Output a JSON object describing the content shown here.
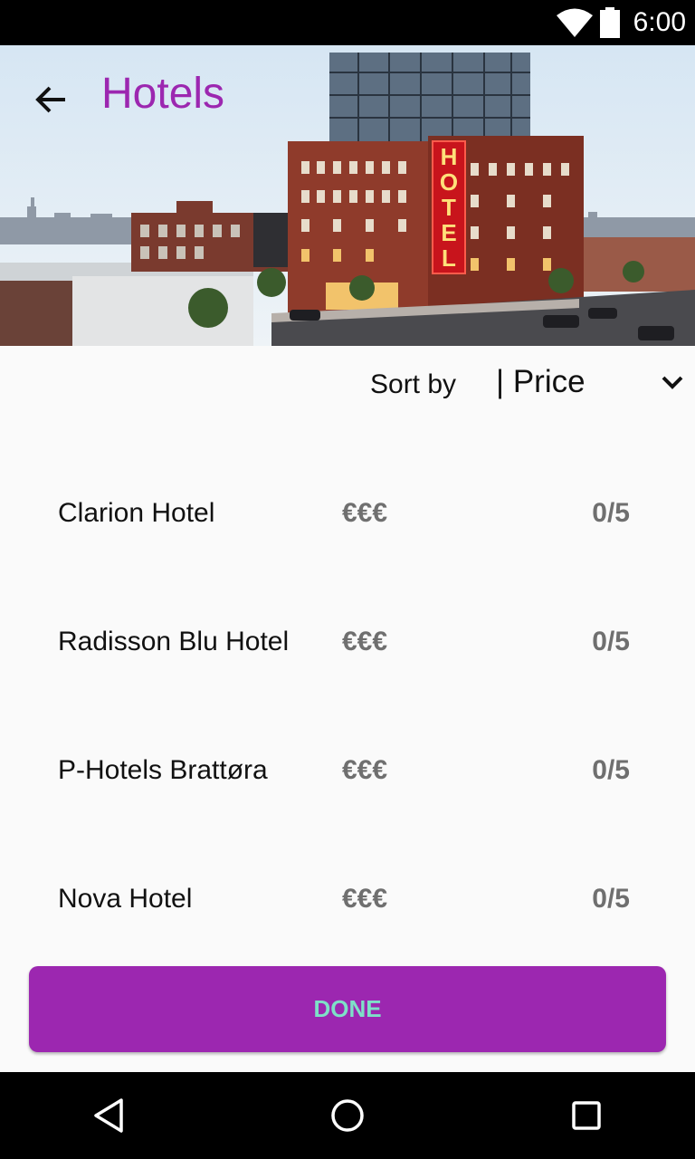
{
  "status_bar": {
    "time": "6:00"
  },
  "header": {
    "title": "Hotels"
  },
  "hero": {
    "sign_letters": [
      "H",
      "O",
      "T",
      "E",
      "L"
    ]
  },
  "sort": {
    "label": "Sort by",
    "value": "| Price"
  },
  "hotels": [
    {
      "name": "Clarion Hotel",
      "price": "€€€",
      "rating": "0/5"
    },
    {
      "name": "Radisson Blu Hotel",
      "price": "€€€",
      "rating": "0/5"
    },
    {
      "name": "P-Hotels Brattøra",
      "price": "€€€",
      "rating": "0/5"
    },
    {
      "name": "Nova Hotel",
      "price": "€€€",
      "rating": "0/5"
    }
  ],
  "done_button": {
    "label": "DONE"
  },
  "colors": {
    "accent": "#9c27b0",
    "done_text": "#7ee0c8",
    "muted_text": "#6f6f6f"
  }
}
